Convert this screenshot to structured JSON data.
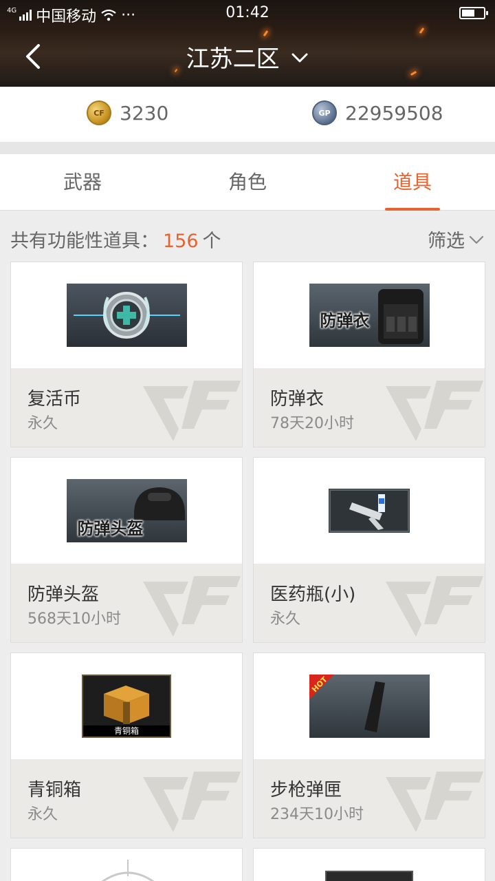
{
  "status_bar": {
    "signal_label": "4G",
    "carrier": "中国移动",
    "more": "···",
    "time": "01:42"
  },
  "header": {
    "title": "江苏二区"
  },
  "currency": {
    "cf_points": "3230",
    "gp": "22959508",
    "cf_coin_label": "CF",
    "gp_coin_label": "GP"
  },
  "tabs": [
    {
      "label": "武器",
      "active": false
    },
    {
      "label": "角色",
      "active": false
    },
    {
      "label": "道具",
      "active": true
    }
  ],
  "summary": {
    "prefix": "共有功能性道具：",
    "count": "156",
    "unit": "个",
    "filter_label": "筛选"
  },
  "items": [
    {
      "name": "复活币",
      "duration": "永久",
      "thumb_label": "",
      "icon": "revive-coin-icon"
    },
    {
      "name": "防弹衣",
      "duration": "78天20小时",
      "thumb_label": "防弹衣",
      "icon": "vest-icon"
    },
    {
      "name": "防弹头盔",
      "duration": "568天10小时",
      "thumb_label": "防弹头盔",
      "icon": "helmet-icon"
    },
    {
      "name": "医药瓶(小)",
      "duration": "永久",
      "thumb_label": "",
      "icon": "medkit-icon"
    },
    {
      "name": "青铜箱",
      "duration": "永久",
      "thumb_label": "青铜箱",
      "icon": "bronze-box-icon"
    },
    {
      "name": "步枪弹匣",
      "duration": "234天10小时",
      "thumb_label": "HOT",
      "icon": "rifle-magazine-icon"
    }
  ],
  "colors": {
    "accent": "#e8622d",
    "header_bg": "#2a1d14",
    "card_bottom": "#ebeae6"
  }
}
